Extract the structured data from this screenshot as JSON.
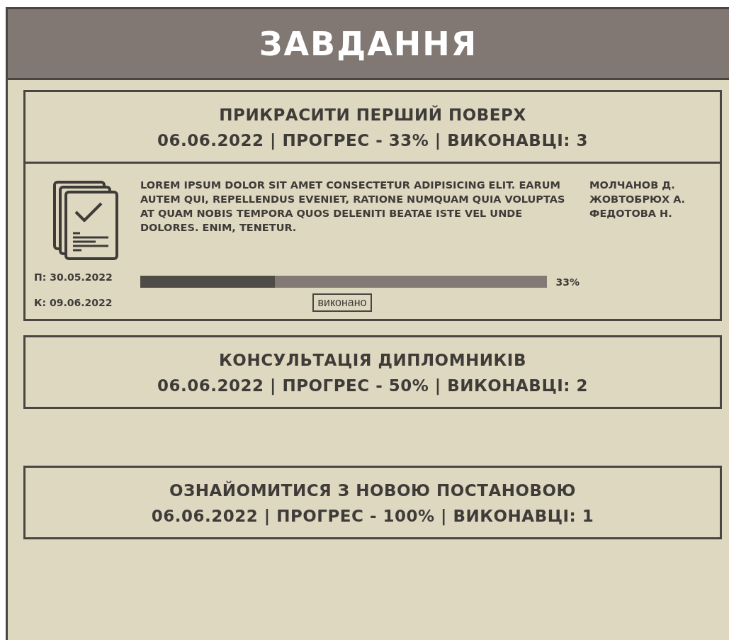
{
  "header": {
    "title": "ЗАВДАННЯ"
  },
  "tasks": [
    {
      "title": "ПРИКРАСИТИ ПЕРШИЙ ПОВЕРХ",
      "subtitle": "06.06.2022 | ПРОГРЕС - 33% | ВИКОНАВЦІ: 3",
      "expanded": true,
      "description": "LOREM IPSUM DOLOR SIT AMET CONSECTETUR ADIPISICING ELIT. EARUM AUTEM QUI, REPELLENDUS EVENIET, RATIONE NUMQUAM QUIA VOLUPTAS AT QUAM NOBIS TEMPORA QUOS DELENITI BEATAE ISTE VEL UNDE DOLORES. ENIM, TENETUR.",
      "assignees": [
        "МОЛЧАНОВ Д.",
        "ЖОВТОБРЮХ А.",
        "ФЕДОТОВА Н."
      ],
      "start": "П: 30.05.2022",
      "end": "К: 09.06.2022",
      "level": 0.33,
      "reading": "33%",
      "button": "виконано"
    },
    {
      "title": "КОНСУЛЬТАЦІЯ ДИПЛОМНИКІВ",
      "subtitle": "06.06.2022 | ПРОГРЕС - 50% | ВИКОНАВЦІ: 2",
      "expanded": false
    },
    {
      "title": "ОЗНАЙОМИТИСЯ З НОВОЮ ПОСТАНОВОЮ",
      "subtitle": "06.06.2022 | ПРОГРЕС - 100% | ВИКОНАВЦІ: 1",
      "expanded": false
    }
  ]
}
